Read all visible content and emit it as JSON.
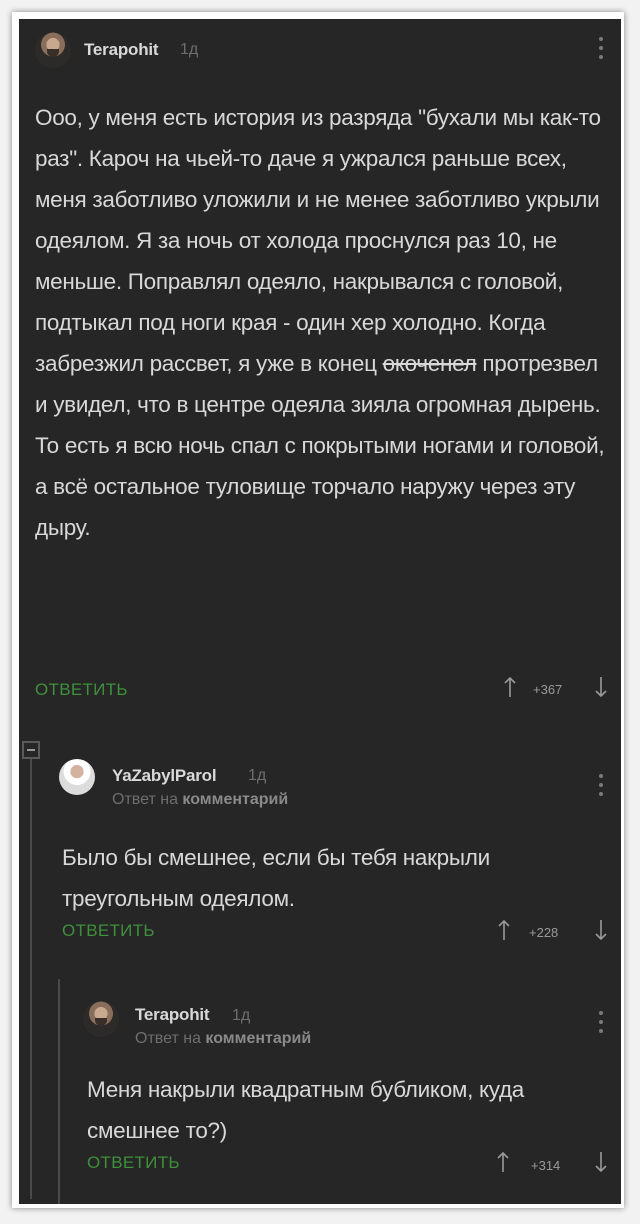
{
  "comments": [
    {
      "username": "Terapohit",
      "time": "1д",
      "text_before": "Ооо, у меня есть история из разряда \"бухали мы как-то раз\". Кароч на чьей-то даче я ужрался раньше всех, меня заботливо уложили и не менее заботливо укрыли одеялом. Я за ночь от холода проснулся раз 10, не меньше. Поправлял одеяло, накрывался с головой, подтыкал под ноги края - один хер холодно. Когда забрезжил рассвет, я уже в конец ",
      "text_struck": "окоченел",
      "text_after": " протрезвел и увидел, что в центре одеяла зияла огромная дырень. То есть я всю ночь спал с покрытыми ногами и головой, а всё остальное туловище торчало наружу через эту дыру.",
      "reply_label": "ОТВЕТИТЬ",
      "votes": "+367"
    },
    {
      "username": "YaZabylParol",
      "time": "1д",
      "reply_to_prefix": "Ответ на",
      "reply_to_target": "комментарий",
      "text": "Было бы смешнее, если бы тебя накрыли треугольным одеялом.",
      "reply_label": "ОТВЕТИТЬ",
      "votes": "+228"
    },
    {
      "username": "Terapohit",
      "time": "1д",
      "reply_to_prefix": "Ответ на",
      "reply_to_target": "комментарий",
      "text": "Меня накрыли квадратным бубликом, куда смешнее то?)",
      "reply_label": "ОТВЕТИТЬ",
      "votes": "+314"
    }
  ],
  "colors": {
    "background": "#262627",
    "text": "#d8d8d8",
    "reply_green": "#3f8f3b",
    "muted": "#6e6e6e"
  },
  "icons": {
    "upvote": "arrow-up-icon",
    "downvote": "arrow-down-icon",
    "menu": "kebab-menu-icon",
    "collapse": "collapse-minus-icon"
  }
}
